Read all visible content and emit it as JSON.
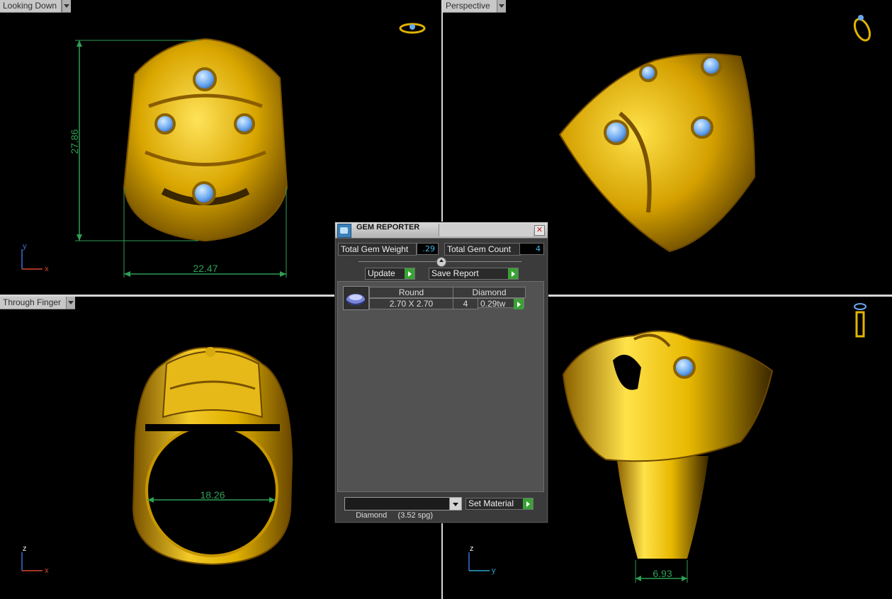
{
  "viewports": {
    "top_left": {
      "label": "Looking Down",
      "dim_vertical": "27.86",
      "dim_horizontal": "22.47",
      "axis_v": "y",
      "axis_h": "x"
    },
    "top_right": {
      "label": "Perspective"
    },
    "bottom_left": {
      "label": "Through Finger",
      "dim_horizontal": "18.26",
      "axis_v": "z",
      "axis_h": "x"
    },
    "bottom_right": {
      "dim_horizontal": "6.93",
      "axis_v": "z",
      "axis_h": "y"
    }
  },
  "gem_reporter": {
    "title": "GEM REPORTER",
    "close": "✕",
    "total_weight_label": "Total Gem Weight",
    "total_weight_value": ".29",
    "total_count_label": "Total Gem Count",
    "total_count_value": "4",
    "update_label": "Update",
    "save_report_label": "Save Report",
    "gems": [
      {
        "shape": "Round",
        "size": "2.70 X 2.70",
        "material": "Diamond",
        "count": "4",
        "weight": "0.29tw"
      }
    ],
    "material_select": "Diamond     (3.52 spg)",
    "set_material_label": "Set Material"
  },
  "colors": {
    "gold": "#e1b400",
    "gem": "#6aa8f0",
    "dimension": "#2f9e54",
    "value_text": "#4ab3e6"
  }
}
